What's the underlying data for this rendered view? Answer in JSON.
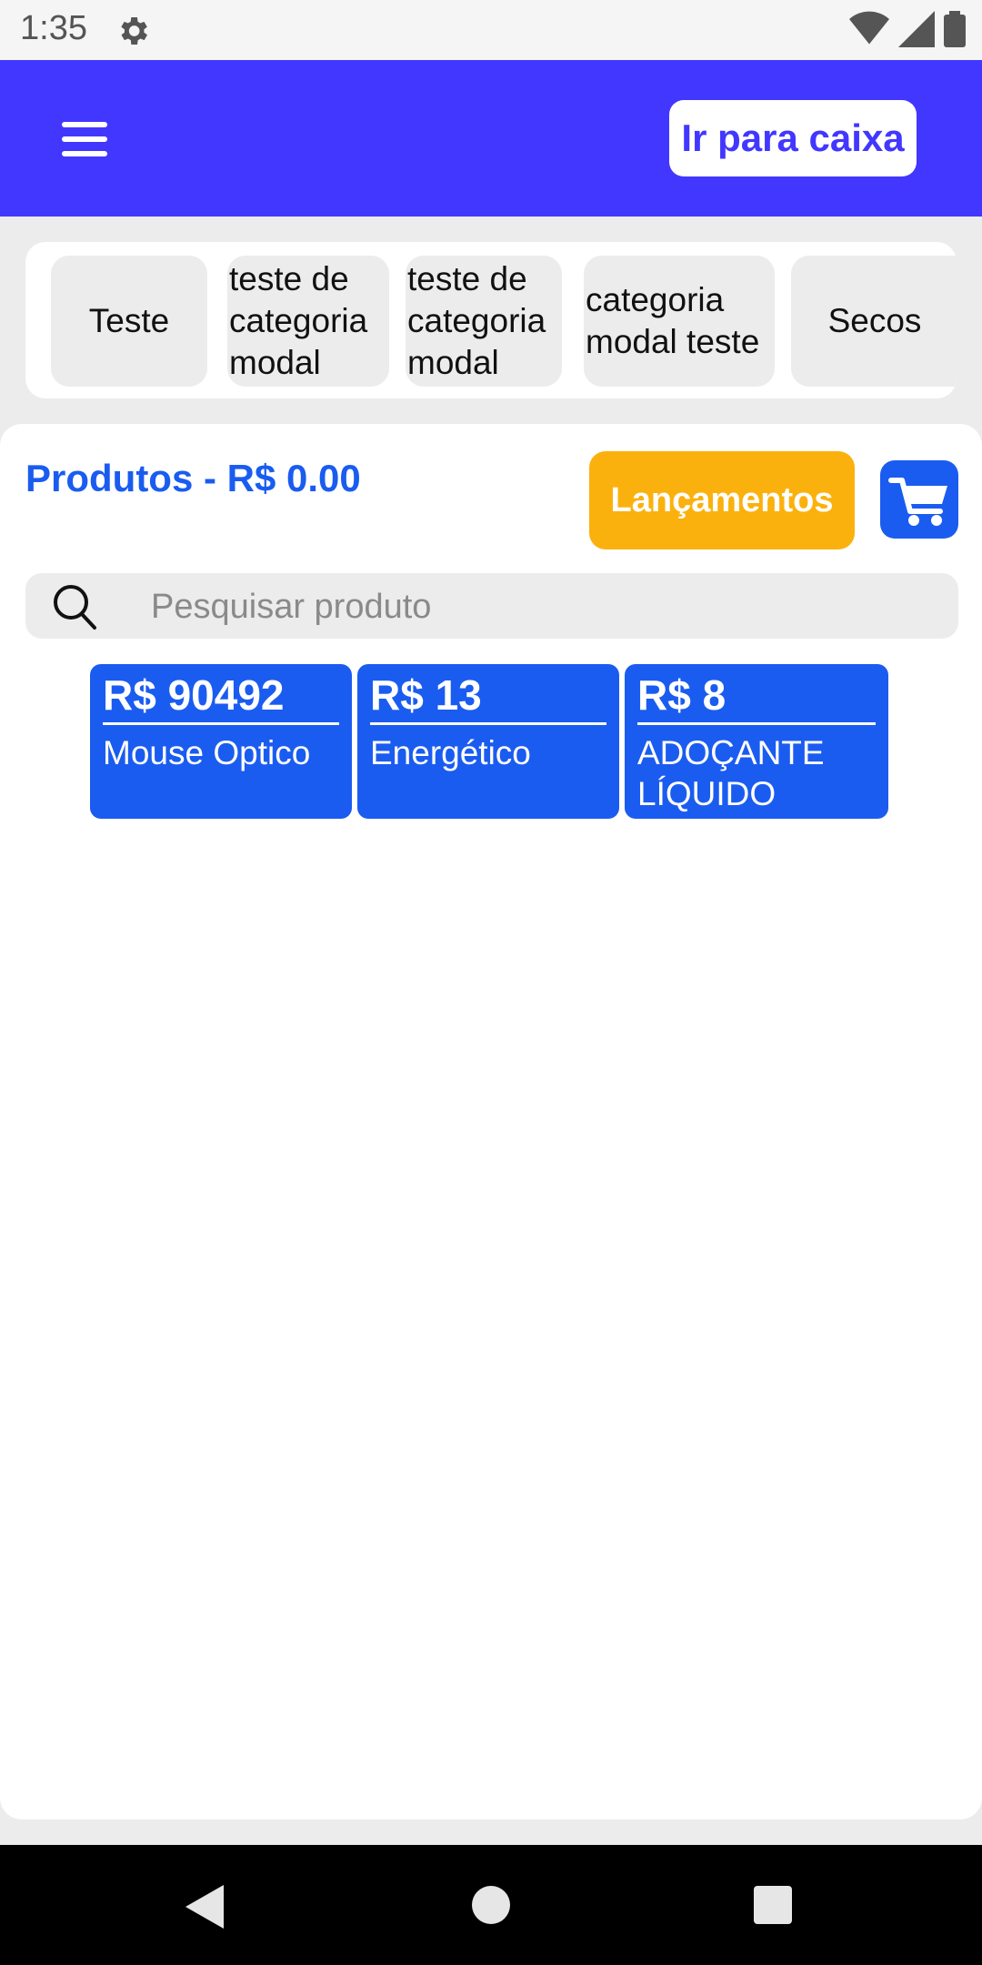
{
  "status_bar": {
    "time": "1:35"
  },
  "app_bar": {
    "go_to_cashier": "Ir para caixa"
  },
  "categories": [
    {
      "label": "Teste"
    },
    {
      "label": "teste de categoria modal"
    },
    {
      "label": "teste de categoria modal"
    },
    {
      "label": "categoria modal teste"
    },
    {
      "label": "Secos"
    }
  ],
  "main": {
    "title": "Produtos - R$ 0.00",
    "launches_label": "Lançamentos",
    "search_placeholder": "Pesquisar produto"
  },
  "products": [
    {
      "price": "R$ 90492",
      "name": "Mouse Optico"
    },
    {
      "price": "R$ 13",
      "name": "Energético"
    },
    {
      "price": "R$ 8",
      "name": "ADOÇANTE LÍQUIDO"
    }
  ],
  "colors": {
    "app_bar": "#4237ff",
    "primary_blue": "#1b5cf0",
    "accent_orange": "#fbb10d"
  }
}
